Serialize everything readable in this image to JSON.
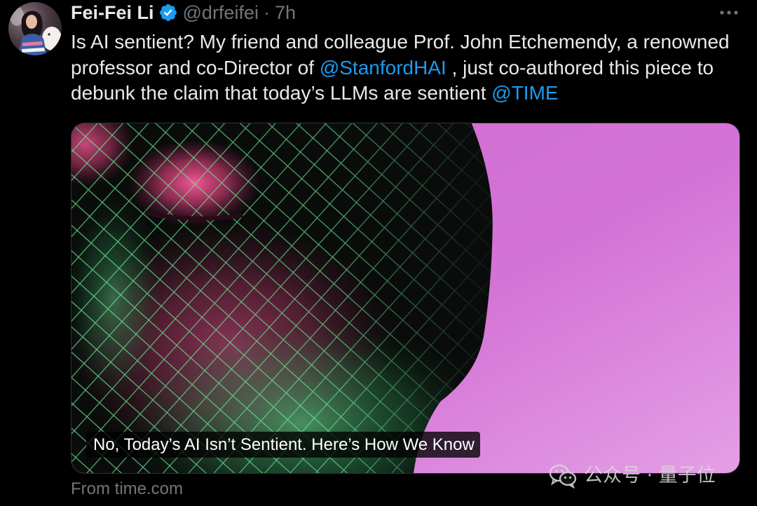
{
  "colors": {
    "background": "#000000",
    "text_primary": "#e7e9ea",
    "text_secondary": "#71767b",
    "link": "#1d9bf0",
    "verified_badge": "#1d9bf0"
  },
  "tweet": {
    "author": {
      "name": "Fei-Fei Li",
      "handle": "@drfeifei",
      "separator": "·",
      "time": "7h",
      "verified": true,
      "avatar_icon": "avatar-photo",
      "verified_icon": "verified-badge-icon"
    },
    "more_icon": "more-horizontal-icon",
    "text": [
      "Is AI sentient? My friend and colleague Prof. John Etchemendy, a renowned professor and co-Director of ",
      "@StanfordHAI",
      " , just co-authored this piece to debunk the claim that today’s LLMs are sentient ",
      "@TIME"
    ],
    "card": {
      "headline": "No, Today’s AI Isn’t Sentient. Here’s How We Know",
      "source": "From time.com"
    }
  },
  "watermark": {
    "icon": "wechat-icon",
    "text": "公众号 · 量子位"
  }
}
